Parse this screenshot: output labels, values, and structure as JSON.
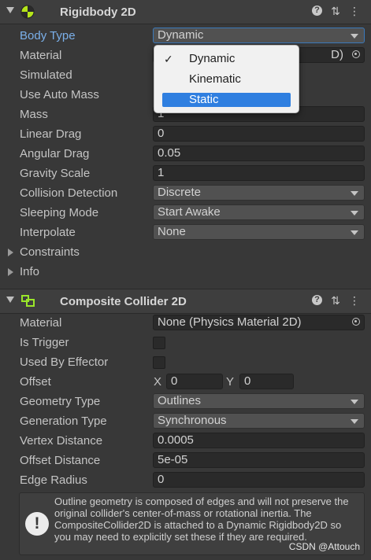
{
  "rigidbody": {
    "title": "Rigidbody 2D",
    "body_type": {
      "label": "Body Type",
      "value": "Dynamic"
    },
    "material": {
      "label": "Material",
      "value": "None (Physics Material 2D)",
      "visible_tail": "D)"
    },
    "simulated": {
      "label": "Simulated"
    },
    "use_auto_mass": {
      "label": "Use Auto Mass"
    },
    "mass": {
      "label": "Mass",
      "value": "1"
    },
    "linear_drag": {
      "label": "Linear Drag",
      "value": "0"
    },
    "angular_drag": {
      "label": "Angular Drag",
      "value": "0.05"
    },
    "gravity_scale": {
      "label": "Gravity Scale",
      "value": "1"
    },
    "collision_detection": {
      "label": "Collision Detection",
      "value": "Discrete"
    },
    "sleeping_mode": {
      "label": "Sleeping Mode",
      "value": "Start Awake"
    },
    "interpolate": {
      "label": "Interpolate",
      "value": "None"
    },
    "constraints": {
      "label": "Constraints"
    },
    "info": {
      "label": "Info"
    }
  },
  "body_type_menu": {
    "options": [
      "Dynamic",
      "Kinematic",
      "Static"
    ],
    "checked": "Dynamic",
    "highlighted": "Static"
  },
  "composite": {
    "title": "Composite Collider 2D",
    "material": {
      "label": "Material",
      "value": "None (Physics Material 2D)"
    },
    "is_trigger": {
      "label": "Is Trigger"
    },
    "used_by_effector": {
      "label": "Used By Effector"
    },
    "offset": {
      "label": "Offset",
      "x_label": "X",
      "x": "0",
      "y_label": "Y",
      "y": "0"
    },
    "geometry_type": {
      "label": "Geometry Type",
      "value": "Outlines"
    },
    "generation_type": {
      "label": "Generation Type",
      "value": "Synchronous"
    },
    "vertex_distance": {
      "label": "Vertex Distance",
      "value": "0.0005"
    },
    "offset_distance": {
      "label": "Offset Distance",
      "value": "5e-05"
    },
    "edge_radius": {
      "label": "Edge Radius",
      "value": "0"
    },
    "help": "Outline geometry is composed of edges and will not preserve the original collider's center-of-mass or rotational inertia. The CompositeCollider2D is attached to a Dynamic Rigidbody2D so you may need to explicitly set these if they are required."
  },
  "watermark": "CSDN @Attouch",
  "icons": {
    "help": "question-icon",
    "presets": "sliders-icon",
    "more": "kebab-icon",
    "rigidbody": "rigidbody-component-icon",
    "composite": "composite-collider-icon",
    "info": "info-icon",
    "object_picker": "object-picker-icon"
  },
  "colors": {
    "accent": "#3a79bb",
    "selected_item": "#2f7fe0",
    "active_label": "#7bb0ea"
  }
}
